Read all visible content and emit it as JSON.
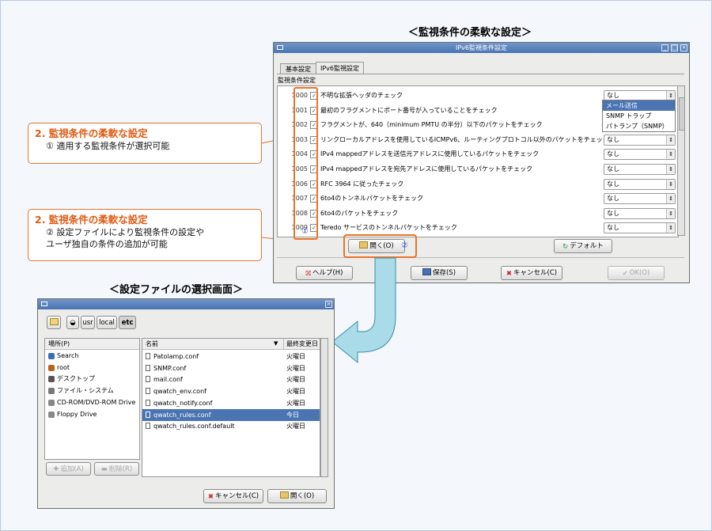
{
  "headings": {
    "monitor": "＜監視条件の柔軟な設定＞",
    "file_select": "＜設定ファイルの選択画面＞"
  },
  "callouts": [
    {
      "title": "2. 監視条件の柔軟な設定",
      "lines": [
        "① 適用する監視条件が選択可能"
      ]
    },
    {
      "title": "2. 監視条件の柔軟な設定",
      "lines": [
        "② 設定ファイルにより監視条件の設定や",
        "ユーザ独自の条件の追加が可能"
      ]
    }
  ],
  "marker_labels": {
    "one": "①",
    "two": "②"
  },
  "ipv6_window": {
    "title": "IPv6監視条件設定",
    "tabs": [
      "基本設定",
      "IPv6監視設定"
    ],
    "section_label": "監視条件設定",
    "rows": [
      {
        "id": "1000",
        "text": "不明な拡張ヘッダのチェック",
        "value": "なし"
      },
      {
        "id": "1001",
        "text": "最初のフラグメントにポート番号が入っていることをチェック",
        "value": ""
      },
      {
        "id": "1002",
        "text": "フラグメントが、640（minimum PMTU の半分）以下のパケットをチェック",
        "value": ""
      },
      {
        "id": "1003",
        "text": "リンクローカルアドレスを使用しているICMPv6、ルーティングプロトコル以外のパケットをチェック",
        "value": "なし"
      },
      {
        "id": "1004",
        "text": "IPv4 mappedアドレスを送信元アドレスに使用しているパケットをチェック",
        "value": "なし"
      },
      {
        "id": "1005",
        "text": "IPv4 mappedアドレスを宛先アドレスに使用しているパケットをチェック",
        "value": "なし"
      },
      {
        "id": "1006",
        "text": "RFC 3964 に従ったチェック",
        "value": "なし"
      },
      {
        "id": "1007",
        "text": "6to4のトンネルパケットをチェック",
        "value": "なし"
      },
      {
        "id": "1008",
        "text": "6to4のパケットをチェック",
        "value": "なし"
      },
      {
        "id": "1009",
        "text": "Teredo サービスのトンネルパケットをチェック",
        "value": "なし"
      }
    ],
    "dropdown_options": [
      "メール送信",
      "SNMP トラップ",
      "パトランプ（SNMP）"
    ],
    "open_button": "開く(O)",
    "default_button": "デフォルト",
    "help_button": "ヘルプ(H)",
    "save_button": "保存(S)",
    "cancel_button": "キャンセル(C)",
    "ok_button": "OK(O)"
  },
  "file_dialog": {
    "path_buttons": [
      "usr",
      "local",
      "etc"
    ],
    "places_header": "場所(P)",
    "places": [
      "Search",
      "root",
      "デスクトップ",
      "ファイル・システム",
      "CD-ROM/DVD-ROM Drive",
      "Floppy Drive"
    ],
    "col_name": "名前",
    "col_modified": "最終変更日",
    "files": [
      {
        "name": "Patolamp.conf",
        "date": "火曜日"
      },
      {
        "name": "SNMP.conf",
        "date": "火曜日"
      },
      {
        "name": "mail.conf",
        "date": "火曜日"
      },
      {
        "name": "qwatch_env.conf",
        "date": "火曜日"
      },
      {
        "name": "qwatch_notify.conf",
        "date": "火曜日"
      },
      {
        "name": "qwatch_rules.conf",
        "date": "今日"
      },
      {
        "name": "qwatch_rules.conf.default",
        "date": "火曜日"
      }
    ],
    "add_button": "追加(A)",
    "remove_button": "削除(R)",
    "cancel_button": "キャンセル(C)",
    "open_button": "開く(O)"
  },
  "colors": {
    "accent_orange": "#e8742a",
    "title_orange": "#e05a12",
    "titlebar_blue": "#4a74b2",
    "arrow_cyan": "#a9dbe8"
  }
}
